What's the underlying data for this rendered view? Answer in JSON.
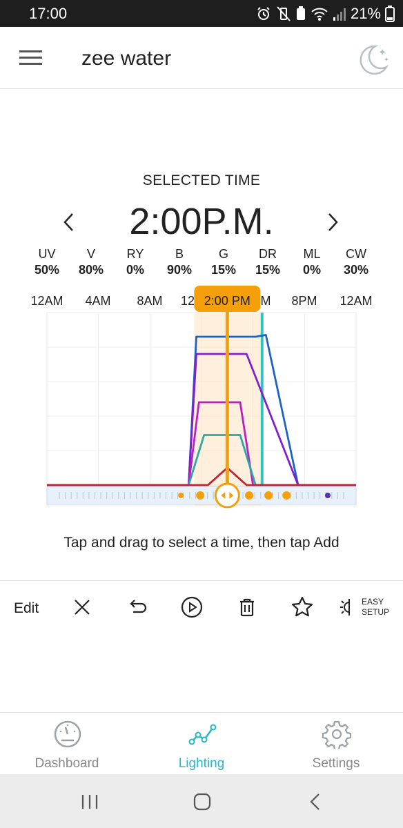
{
  "status_bar": {
    "time": "17:00",
    "battery": "21%"
  },
  "app_bar": {
    "title": "zee water"
  },
  "schedule": {
    "selected_label": "SELECTED TIME",
    "selected_time": "2:00P.M.",
    "channels": [
      {
        "name": "UV",
        "value": "50%"
      },
      {
        "name": "V",
        "value": "80%"
      },
      {
        "name": "RY",
        "value": "0%"
      },
      {
        "name": "B",
        "value": "90%"
      },
      {
        "name": "G",
        "value": "15%"
      },
      {
        "name": "DR",
        "value": "15%"
      },
      {
        "name": "ML",
        "value": "0%"
      },
      {
        "name": "CW",
        "value": "30%"
      }
    ],
    "hour_labels": [
      "12AM",
      "4AM",
      "8AM",
      "12",
      "4PM",
      "8PM",
      "12AM"
    ],
    "visible_partial_label": "M",
    "cursor_label": "2:00 PM",
    "hint": "Tap and drag to select a time, then tap Add"
  },
  "chart_data": {
    "type": "line",
    "xlabel": "",
    "ylabel": "",
    "x_unit": "hour of day",
    "xlim": [
      0,
      24
    ],
    "ylim": [
      0,
      100
    ],
    "selected_hour": 14,
    "accent_color": "#f5a00a",
    "marker_line_color": "#2ec4c0",
    "series": [
      {
        "color": "#1e63c0",
        "points": [
          [
            0,
            0
          ],
          [
            11,
            0
          ],
          [
            11.6,
            86
          ],
          [
            16.2,
            86
          ],
          [
            17,
            87
          ],
          [
            19.5,
            0
          ],
          [
            24,
            0
          ]
        ]
      },
      {
        "color": "#7f20c8",
        "points": [
          [
            0,
            0
          ],
          [
            11,
            0
          ],
          [
            11.6,
            76
          ],
          [
            15.5,
            76
          ],
          [
            19.5,
            0
          ],
          [
            24,
            0
          ]
        ]
      },
      {
        "color": "#bc1ec2",
        "points": [
          [
            0,
            0
          ],
          [
            11,
            0
          ],
          [
            11.8,
            48
          ],
          [
            15,
            48
          ],
          [
            16,
            0
          ],
          [
            24,
            0
          ]
        ]
      },
      {
        "color": "#2aa8a8",
        "points": [
          [
            0,
            0
          ],
          [
            11,
            0
          ],
          [
            12.2,
            29
          ],
          [
            15,
            29
          ],
          [
            16.2,
            0
          ],
          [
            24,
            0
          ]
        ]
      },
      {
        "color": "#c42030",
        "points": [
          [
            0,
            0
          ],
          [
            12.5,
            0
          ],
          [
            14,
            10
          ],
          [
            15.5,
            0
          ],
          [
            24,
            0
          ]
        ]
      }
    ],
    "event_markers_hours": [
      10.4,
      11.9,
      15.7,
      17.2,
      18.6
    ],
    "end_marker_hour": 21.8
  },
  "toolbar": {
    "edit_label": "Edit",
    "easy_setup_line1": "EASY",
    "easy_setup_line2": "SETUP",
    "tools": [
      "close-icon",
      "undo-icon",
      "play-icon",
      "trash-icon",
      "star-icon",
      "brightness-icon"
    ]
  },
  "bottom_nav": {
    "items": [
      {
        "label": "Dashboard",
        "icon": "gauge-icon",
        "active": false
      },
      {
        "label": "Lighting",
        "icon": "trend-line-icon",
        "active": true
      },
      {
        "label": "Settings",
        "icon": "gear-icon",
        "active": false
      }
    ]
  }
}
